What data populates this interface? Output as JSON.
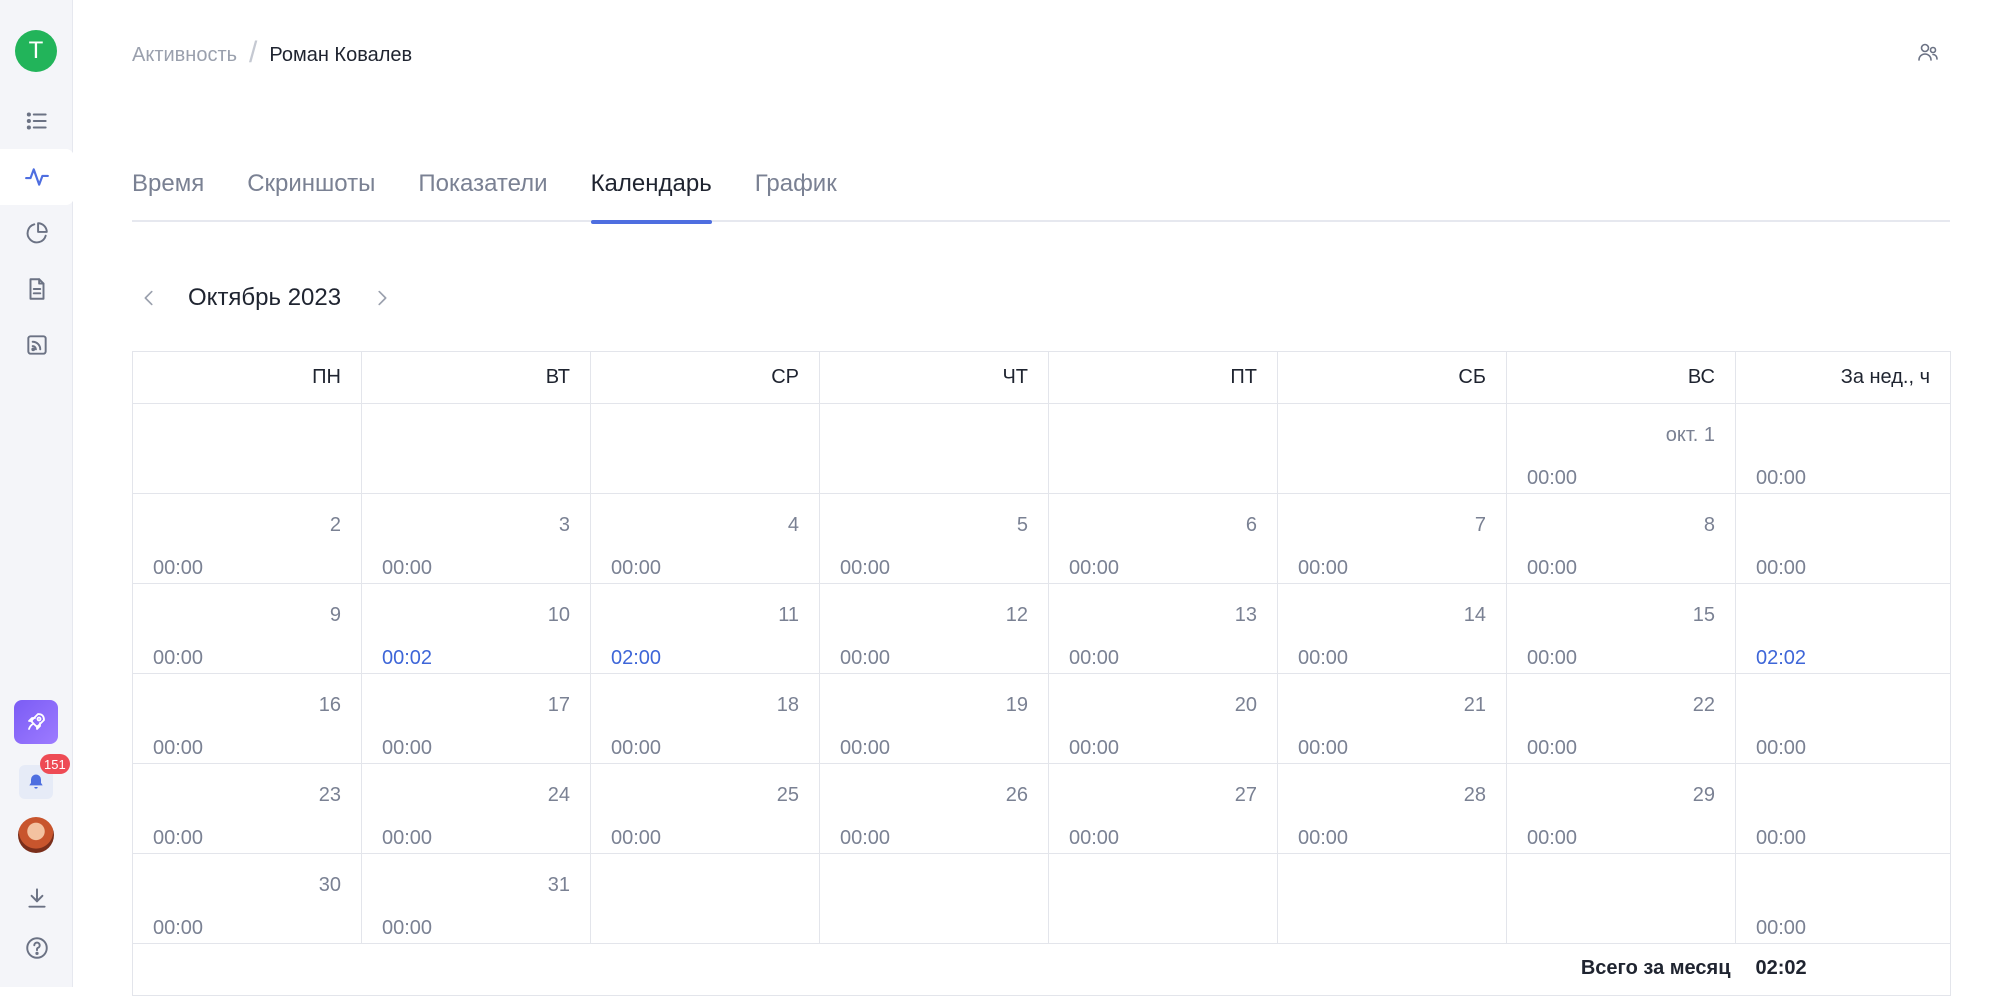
{
  "sidebar": {
    "workspace_letter": "T",
    "notifications_count": "151"
  },
  "breadcrumb": {
    "parent": "Активность",
    "current": "Роман Ковалев"
  },
  "tabs": [
    {
      "label": "Время",
      "active": false
    },
    {
      "label": "Скриншоты",
      "active": false
    },
    {
      "label": "Показатели",
      "active": false
    },
    {
      "label": "Календарь",
      "active": true
    },
    {
      "label": "График",
      "active": false
    }
  ],
  "month": {
    "label": "Октябрь 2023"
  },
  "calendar": {
    "headers": [
      "ПН",
      "ВТ",
      "СР",
      "ЧТ",
      "ПТ",
      "СБ",
      "ВС",
      "За нед., ч"
    ],
    "weeks": [
      {
        "days": [
          null,
          null,
          null,
          null,
          null,
          null,
          {
            "label": "окт. 1",
            "hours": "00:00"
          }
        ],
        "total": "00:00"
      },
      {
        "days": [
          {
            "label": "2",
            "hours": "00:00"
          },
          {
            "label": "3",
            "hours": "00:00"
          },
          {
            "label": "4",
            "hours": "00:00"
          },
          {
            "label": "5",
            "hours": "00:00"
          },
          {
            "label": "6",
            "hours": "00:00"
          },
          {
            "label": "7",
            "hours": "00:00"
          },
          {
            "label": "8",
            "hours": "00:00"
          }
        ],
        "total": "00:00"
      },
      {
        "days": [
          {
            "label": "9",
            "hours": "00:00"
          },
          {
            "label": "10",
            "hours": "00:02",
            "highlight": true
          },
          {
            "label": "11",
            "hours": "02:00",
            "highlight": true
          },
          {
            "label": "12",
            "hours": "00:00"
          },
          {
            "label": "13",
            "hours": "00:00"
          },
          {
            "label": "14",
            "hours": "00:00"
          },
          {
            "label": "15",
            "hours": "00:00"
          }
        ],
        "total": "02:02",
        "total_highlight": true
      },
      {
        "days": [
          {
            "label": "16",
            "hours": "00:00"
          },
          {
            "label": "17",
            "hours": "00:00"
          },
          {
            "label": "18",
            "hours": "00:00"
          },
          {
            "label": "19",
            "hours": "00:00"
          },
          {
            "label": "20",
            "hours": "00:00"
          },
          {
            "label": "21",
            "hours": "00:00"
          },
          {
            "label": "22",
            "hours": "00:00"
          }
        ],
        "total": "00:00"
      },
      {
        "days": [
          {
            "label": "23",
            "hours": "00:00"
          },
          {
            "label": "24",
            "hours": "00:00"
          },
          {
            "label": "25",
            "hours": "00:00"
          },
          {
            "label": "26",
            "hours": "00:00"
          },
          {
            "label": "27",
            "hours": "00:00"
          },
          {
            "label": "28",
            "hours": "00:00"
          },
          {
            "label": "29",
            "hours": "00:00"
          }
        ],
        "total": "00:00"
      },
      {
        "days": [
          {
            "label": "30",
            "hours": "00:00"
          },
          {
            "label": "31",
            "hours": "00:00"
          },
          null,
          null,
          null,
          null,
          null
        ],
        "total": "00:00"
      }
    ],
    "month_total_label": "Всего за месяц",
    "month_total_value": "02:02"
  },
  "colors": {
    "accent": "#4e6ee0",
    "highlight_text": "#3e66d8",
    "workspace_avatar": "#22b45a",
    "badge": "#ee4b55"
  }
}
